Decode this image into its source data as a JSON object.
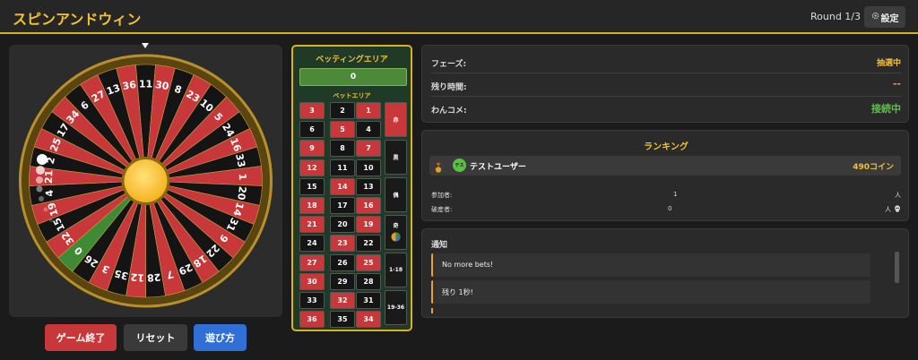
{
  "header": {
    "title": "スピンアンドウィン",
    "round": "Round 1/3",
    "settings_label": "設定",
    "settings_icon": "gear-icon"
  },
  "wheel": {
    "numbers": [
      "0",
      "32",
      "15",
      "19",
      "4",
      "21",
      "2",
      "25",
      "17",
      "34",
      "6",
      "27",
      "13",
      "36",
      "11",
      "30",
      "8",
      "23",
      "10",
      "5",
      "24",
      "16",
      "33",
      "1",
      "20",
      "14",
      "31",
      "9",
      "22",
      "18",
      "29",
      "7",
      "28",
      "12",
      "35",
      "3",
      "26"
    ],
    "colors": {
      "red": "#c8383a",
      "black": "#141414",
      "green": "#3f8a34",
      "rim": "#b8902a",
      "hub": "#f6b21e"
    }
  },
  "controls": {
    "end_label": "ゲーム終了",
    "reset_label": "リセット",
    "howto_label": "遊び方"
  },
  "betting": {
    "title": "ベッティングエリア",
    "amount": "0",
    "sub_title": "ベットエリア",
    "grid": [
      [
        {
          "n": "3",
          "c": "red"
        },
        {
          "n": "2",
          "c": "black"
        },
        {
          "n": "1",
          "c": "red"
        }
      ],
      [
        {
          "n": "6",
          "c": "black"
        },
        {
          "n": "5",
          "c": "red"
        },
        {
          "n": "4",
          "c": "black"
        }
      ],
      [
        {
          "n": "9",
          "c": "red"
        },
        {
          "n": "8",
          "c": "black"
        },
        {
          "n": "7",
          "c": "red"
        }
      ],
      [
        {
          "n": "12",
          "c": "red"
        },
        {
          "n": "11",
          "c": "black"
        },
        {
          "n": "10",
          "c": "black"
        }
      ],
      [
        {
          "n": "15",
          "c": "black"
        },
        {
          "n": "14",
          "c": "red"
        },
        {
          "n": "13",
          "c": "black"
        }
      ],
      [
        {
          "n": "18",
          "c": "red"
        },
        {
          "n": "17",
          "c": "black"
        },
        {
          "n": "16",
          "c": "red"
        }
      ],
      [
        {
          "n": "21",
          "c": "red"
        },
        {
          "n": "20",
          "c": "black"
        },
        {
          "n": "19",
          "c": "red"
        }
      ],
      [
        {
          "n": "24",
          "c": "black"
        },
        {
          "n": "23",
          "c": "red"
        },
        {
          "n": "22",
          "c": "black"
        }
      ],
      [
        {
          "n": "27",
          "c": "red"
        },
        {
          "n": "26",
          "c": "black"
        },
        {
          "n": "25",
          "c": "red"
        }
      ],
      [
        {
          "n": "30",
          "c": "red"
        },
        {
          "n": "29",
          "c": "black"
        },
        {
          "n": "28",
          "c": "black"
        }
      ],
      [
        {
          "n": "33",
          "c": "black"
        },
        {
          "n": "32",
          "c": "red"
        },
        {
          "n": "31",
          "c": "black"
        }
      ],
      [
        {
          "n": "36",
          "c": "red"
        },
        {
          "n": "35",
          "c": "black"
        },
        {
          "n": "34",
          "c": "red"
        }
      ]
    ],
    "side": [
      {
        "label": "赤",
        "c": "red"
      },
      {
        "label": "黒",
        "c": "black"
      },
      {
        "label": "偶",
        "c": "black"
      },
      {
        "label": "奇",
        "c": "black",
        "icon": "pie-chip-icon"
      },
      {
        "label": "1-18",
        "c": "black"
      },
      {
        "label": "19-36",
        "c": "black"
      }
    ]
  },
  "info": {
    "phase_label": "フェーズ:",
    "phase_value": "抽選中",
    "time_label": "残り時間:",
    "time_value": "--",
    "comment_label": "わんコメ:",
    "comment_value": "接続中"
  },
  "ranking": {
    "title": "ランキング",
    "rows": [
      {
        "rank_icon": "medal-icon",
        "avatar": "テス",
        "name": "テストユーザー",
        "coins": "490コイン"
      }
    ],
    "participants_label": "参加者:",
    "participants_value": "1",
    "participants_unit": "人",
    "bankrupt_label": "破産者:",
    "bankrupt_value": "0",
    "bankrupt_unit": "人",
    "bankrupt_icon": "skull-icon"
  },
  "notices": {
    "title": "通知",
    "messages": [
      "No more bets!",
      "残り 1秒!"
    ]
  }
}
